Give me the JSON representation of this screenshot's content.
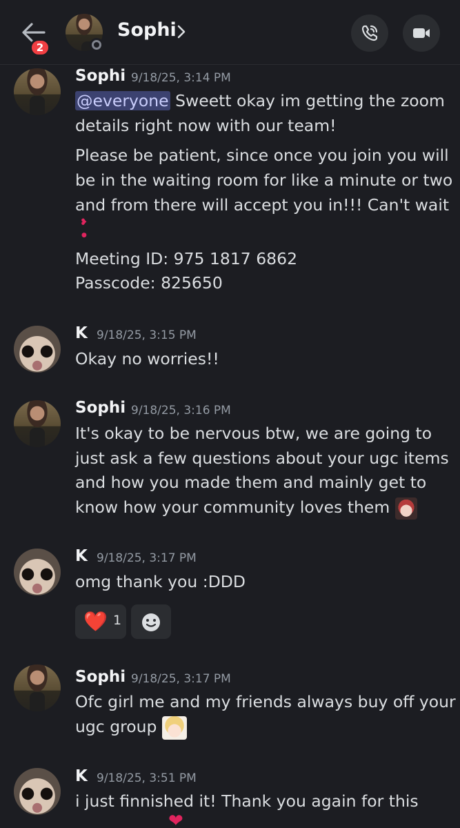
{
  "header": {
    "back_badge": "2",
    "channel_name": "Sophi",
    "call_icon": "phone-call-icon",
    "video_icon": "video-camera-icon"
  },
  "colors": {
    "background": "#1c1d22",
    "mention_bg": "#3c4270",
    "mention_text": "#c9cdfb",
    "badge": "#f23f43",
    "heart": "#e0245e"
  },
  "messages": [
    {
      "author": "Sophi",
      "timestamp": "9/18/25, 3:14 PM",
      "mention": "@everyone",
      "lines": [
        " Sweett okay im getting the zoom",
        "details right now with our team!",
        "Please be patient, since once you join you will",
        "be in the waiting room for like a minute or two",
        "and from there will accept you in!!! Can't wait",
        "Meeting ID:  975 1817 6862",
        "Passcode: 825650"
      ]
    },
    {
      "author": "K",
      "timestamp": "9/18/25, 3:15 PM",
      "lines": [
        "Okay no worries!!"
      ]
    },
    {
      "author": "Sophi",
      "timestamp": "9/18/25, 3:16 PM",
      "lines": [
        "It's okay to be nervous btw, we are going to",
        "just ask a few questions about your ugc items",
        "and how you made them and mainly get to",
        "know how your community loves them "
      ]
    },
    {
      "author": "K",
      "timestamp": "9/18/25, 3:17 PM",
      "lines": [
        "omg thank you :DDD"
      ],
      "reactions": [
        {
          "emoji": "❤️",
          "count": "1"
        }
      ]
    },
    {
      "author": "Sophi",
      "timestamp": "9/18/25, 3:17 PM",
      "lines": [
        "Ofc girl me and my friends always buy off your",
        "ugc group "
      ]
    },
    {
      "author": "K",
      "timestamp": "9/18/25, 3:51 PM",
      "lines": [
        "i just finnished it! Thank you again for this"
      ]
    }
  ]
}
